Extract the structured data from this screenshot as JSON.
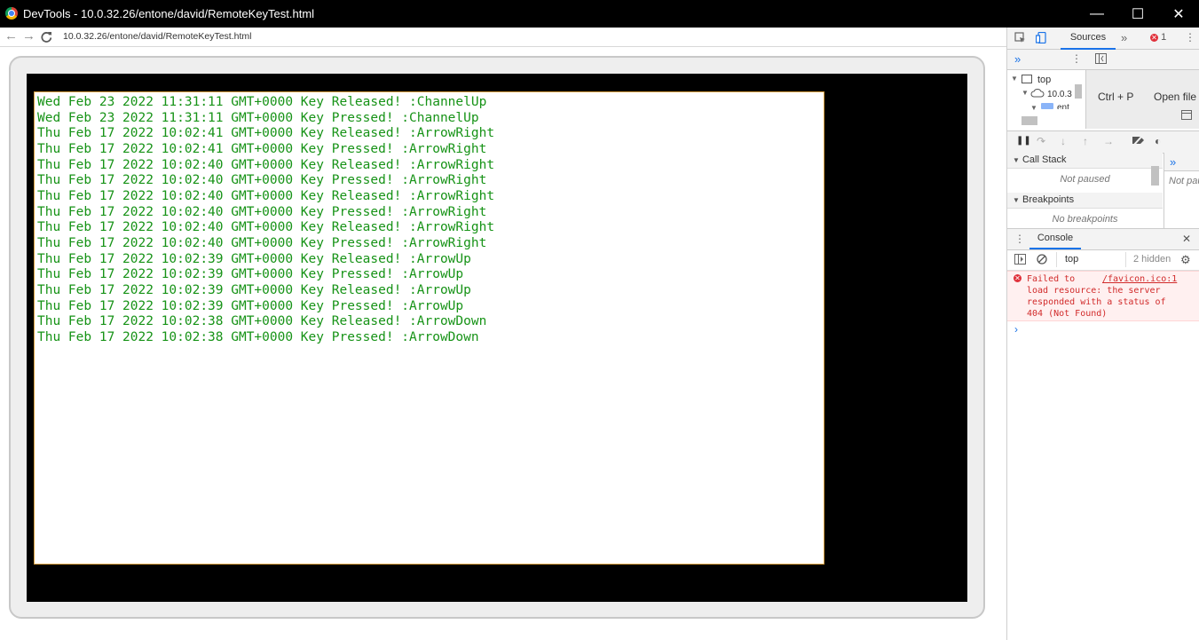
{
  "window": {
    "title": "DevTools - 10.0.32.26/entone/david/RemoteKeyTest.html",
    "minimize": "—",
    "maximize": "☐",
    "close": "✕"
  },
  "address": {
    "back": "←",
    "forward": "→",
    "reload": "C",
    "url": "10.0.32.26/entone/david/RemoteKeyTest.html"
  },
  "log": {
    "lines": [
      "Wed Feb 23 2022 11:31:11 GMT+0000 Key Released! :ChannelUp",
      "Wed Feb 23 2022 11:31:11 GMT+0000 Key Pressed! :ChannelUp",
      "Thu Feb 17 2022 10:02:41 GMT+0000 Key Released! :ArrowRight",
      "Thu Feb 17 2022 10:02:41 GMT+0000 Key Pressed! :ArrowRight",
      "Thu Feb 17 2022 10:02:40 GMT+0000 Key Released! :ArrowRight",
      "Thu Feb 17 2022 10:02:40 GMT+0000 Key Pressed! :ArrowRight",
      "Thu Feb 17 2022 10:02:40 GMT+0000 Key Released! :ArrowRight",
      "Thu Feb 17 2022 10:02:40 GMT+0000 Key Pressed! :ArrowRight",
      "Thu Feb 17 2022 10:02:40 GMT+0000 Key Released! :ArrowRight",
      "Thu Feb 17 2022 10:02:40 GMT+0000 Key Pressed! :ArrowRight",
      "Thu Feb 17 2022 10:02:39 GMT+0000 Key Released! :ArrowUp",
      "Thu Feb 17 2022 10:02:39 GMT+0000 Key Pressed! :ArrowUp",
      "Thu Feb 17 2022 10:02:39 GMT+0000 Key Released! :ArrowUp",
      "Thu Feb 17 2022 10:02:39 GMT+0000 Key Pressed! :ArrowUp",
      "Thu Feb 17 2022 10:02:38 GMT+0000 Key Released! :ArrowDown",
      "Thu Feb 17 2022 10:02:38 GMT+0000 Key Pressed! :ArrowDown"
    ],
    "text_color": "#179317"
  },
  "devtools": {
    "tabs": {
      "sources": "Sources",
      "more": "»",
      "error_count": "1",
      "menu": "⋮"
    },
    "navigator": {
      "more": "»",
      "menu": "⋮",
      "top": "top",
      "host": "10.0.3",
      "folder": "ent"
    },
    "editor": {
      "shortcut": "Ctrl + P",
      "open_file": "Open file"
    },
    "debugger": {
      "call_stack": "Call Stack",
      "not_paused": "Not paused",
      "breakpoints": "Breakpoints",
      "no_breakpoints": "No breakpoints",
      "side_not_paused": "Not pau",
      "side_more": "»"
    },
    "console": {
      "tab": "Console",
      "close": "✕",
      "context": "top",
      "hidden": "2 hidden",
      "error_message": "Failed to load resource: the server responded with a status of 404 (Not Found)",
      "error_source": "/favicon.ico:1",
      "prompt": "›"
    }
  }
}
